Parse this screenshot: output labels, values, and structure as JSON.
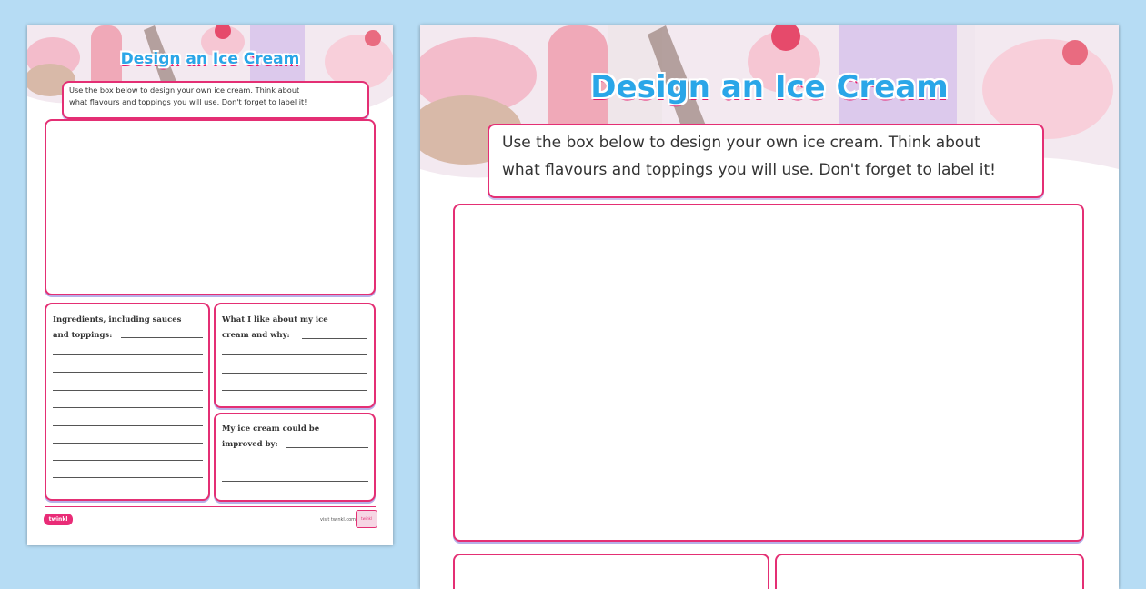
{
  "worksheet": {
    "title": "Design an Ice Cream",
    "instructions": "Use the box below to design your own ice cream. Think about what flavours and toppings you will use. Don't forget to label it!",
    "instructions_line1": "Use the box below to design your own ice cream. Think about",
    "instructions_line2": "what flavours and toppings you will use. Don't forget to label it!",
    "ingredients_label_1": "Ingredients, including sauces",
    "ingredients_label_2": "and toppings:",
    "like_label_1": "What I like about my ice",
    "like_label_2": "cream and why:",
    "improve_label_1": "My ice cream could be",
    "improve_label_2": "improved by:",
    "logo": "twinkl",
    "footer_url": "visit twinkl.com",
    "badge": "twinkl"
  },
  "colors": {
    "background": "#b6dcf4",
    "title_blue": "#2aa6e8",
    "accent_pink": "#e42f74"
  }
}
